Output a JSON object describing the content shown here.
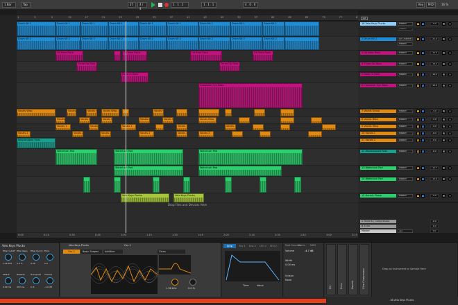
{
  "transport": {
    "bar_select": "1 Bar",
    "tempo": "27",
    "signature": "4 / 4",
    "position": "1 . 1 . 1",
    "loop_start": "1 . 1 . 1",
    "loop_len": "4 . 0 . 0",
    "key": "Key",
    "midi": "MIDI",
    "cpu": "16 %"
  },
  "ruler": {
    "bars": [
      "1",
      "5",
      "9",
      "13",
      "17",
      "21",
      "25",
      "29",
      "33",
      "37",
      "41",
      "45",
      "49",
      "53",
      "57",
      "61",
      "65",
      "69",
      "73",
      "77",
      "81"
    ],
    "times": [
      "0:00",
      "0:15",
      "0:30",
      "0:45",
      "1:00",
      "1:15",
      "1:30",
      "1:45",
      "2:00",
      "2:15",
      "2:30",
      "2:45",
      "3:00",
      "3:15"
    ]
  },
  "arrangement": {
    "drop_hint": "Drop Files and Devices Here",
    "clips": [
      {
        "lane": 0,
        "label": "Drum Kit 1",
        "count": 3
      },
      {
        "lane": 1,
        "label": "Drum Kit 2",
        "count": 3
      },
      {
        "lane": 2,
        "label": "Od Bass Rack",
        "count": 3
      },
      {
        "lane": 3,
        "label": "Three Op Bass",
        "count": 2
      },
      {
        "lane": 4,
        "label": "Deep In Dark",
        "count": 1
      },
      {
        "lane": 5,
        "label": "Crossover Syn Bass",
        "count": 1
      },
      {
        "lane": 6,
        "label": "Vocals Wisp",
        "count": 2
      },
      {
        "lane": 7,
        "label": "Vocals Bliss",
        "count": 2
      },
      {
        "lane": 8,
        "label": "Vocals 1",
        "count": 2
      },
      {
        "lane": 9,
        "label": "Vocals 2",
        "count": 2
      },
      {
        "lane": 10,
        "label": "Waveshaped Pads",
        "count": 1
      },
      {
        "lane": 11,
        "label": "Waterlush Pad",
        "count": 3
      },
      {
        "lane": 12,
        "label": "Waterlush Pad",
        "count": 2
      },
      {
        "lane": 13,
        "label": "Hermit Phase",
        "count": 1
      },
      {
        "lane": 14,
        "label": "Velo Keys Plucks",
        "count": 2
      }
    ]
  },
  "mixer": {
    "tracks": [
      {
        "num": "1",
        "name": "1 Drum Kit 1",
        "input": "All Channel",
        "out": "Master",
        "vol": "-12.0",
        "pan": "C",
        "color": "#1f8dd6"
      },
      {
        "num": "2",
        "name": "2 Drum Kit 2",
        "input": "All Channel",
        "out": "Master",
        "vol": "-21.0",
        "pan": "C",
        "color": "#1f8dd6"
      },
      {
        "num": "3",
        "name": "3 Od Bass Rack",
        "input": "",
        "out": "Master",
        "vol": "-11.5",
        "pan": "C",
        "color": "#c2127e"
      },
      {
        "num": "4",
        "name": "4 Three Op Bass",
        "input": "",
        "out": "Master",
        "vol": "-16.2",
        "pan": "C",
        "color": "#c2127e"
      },
      {
        "num": "5",
        "name": "5 Deep In Dark",
        "input": "",
        "out": "Master",
        "vol": "-14.4",
        "pan": "C",
        "color": "#c2127e"
      },
      {
        "num": "6",
        "name": "6 Crossover Syn Bass",
        "input": "",
        "out": "Master",
        "vol": "-12.0",
        "pan": "C",
        "color": "#c2127e"
      },
      {
        "num": "7",
        "name": "7 Vocals Group",
        "input": "",
        "out": "Master",
        "vol": "-3.0",
        "pan": "C",
        "color": "#e08a14"
      },
      {
        "num": "8",
        "name": "8 Vocals Bliss",
        "input": "",
        "out": "Master",
        "vol": "-9.8",
        "pan": "C",
        "color": "#e08a14"
      },
      {
        "num": "9",
        "name": "9 Vocals Wisp",
        "input": "",
        "out": "Master",
        "vol": "-9.0",
        "pan": "C",
        "color": "#e08a14"
      },
      {
        "num": "10",
        "name": "10 Vocals 1",
        "input": "",
        "out": "Master",
        "vol": "-8.0",
        "pan": "C",
        "color": "#e08a14"
      },
      {
        "num": "11",
        "name": "11 Vocals 2",
        "input": "",
        "out": "Master",
        "vol": "-8.0",
        "pan": "C",
        "color": "#e08a14"
      },
      {
        "num": "12",
        "name": "12 Waveshaped Pads",
        "input": "",
        "out": "Master",
        "vol": "-6.0",
        "pan": "C",
        "color": "#1a9f8e"
      },
      {
        "num": "13",
        "name": "13 Waterlush Pad",
        "input": "",
        "out": "Master",
        "vol": "-12.7",
        "pan": "C",
        "color": "#2ad06b"
      },
      {
        "num": "14",
        "name": "14 Waterlush Pad",
        "input": "",
        "out": "Master",
        "vol": "-13.0",
        "pan": "C",
        "color": "#2ad06b"
      },
      {
        "num": "15",
        "name": "15 Hermit Phase",
        "input": "",
        "out": "Master",
        "vol": "-9.5",
        "pan": "C",
        "color": "#2ad06b"
      },
      {
        "num": "16",
        "name": "16 Velo Keys Plucks",
        "input": "",
        "out": "Master",
        "vol": "-9.0",
        "pan": "C",
        "color": "#8fd1ff"
      }
    ],
    "returns": [
      {
        "name": "A Reverb | Compressor",
        "vol": "-6.0",
        "pan": "C"
      },
      {
        "name": "B Echo",
        "vol": "-6.0",
        "pan": "C"
      }
    ],
    "master": {
      "name": "Master",
      "out": "1/2",
      "vol": "0.0",
      "pan": "C"
    }
  },
  "detail": {
    "instrument": "Velo Keys Plucks",
    "macro_labels": [
      "Filter Cutoff",
      "Filter Reso",
      "Filter Punch",
      "Echo",
      "Attack",
      "Release",
      "Transpose",
      "Volume"
    ],
    "macro_values": [
      "1.44 kHz",
      "0.0 %",
      "0.00",
      "0.0",
      "0.00 ms",
      "210 ms",
      "0 st",
      "-1.0 dB"
    ],
    "wavetable_title": "Velo Keys Plucks",
    "osc_label": "Osc 1",
    "osc_table": "Basic Shapes",
    "osc_wave": "Additive",
    "filter_label": "Clean",
    "filter_freq": "1.96 kHz",
    "filter_res": "0.0 %",
    "env_label": "Amp",
    "env_tabs": [
      "Env 1",
      "Env 2",
      "LFO 1",
      "LFO 2"
    ],
    "env_time": "Time",
    "env_value": "Value",
    "mod_tabs": [
      "Mod Sources",
      "Matrix",
      "MIDI"
    ],
    "volume_label": "Volume",
    "volume_value": "-4.7 dB",
    "width_label": "Width",
    "width_value": "0.00 ms",
    "unison_label": "Unison",
    "unison_mode": "None",
    "effect_tabs": [
      "EQ",
      "Echo",
      "Reverb",
      "Glue Compressor"
    ],
    "drop_hint": "Drop an Instrument or Sample Here"
  },
  "status": {
    "right": "16-Velo Keys Plucks"
  }
}
